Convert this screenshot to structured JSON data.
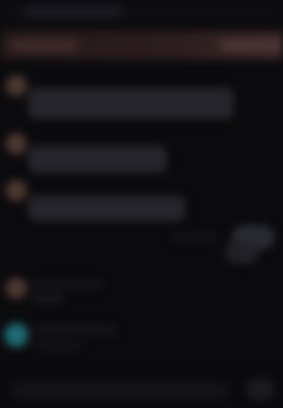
{
  "app": {
    "header_title": "",
    "background": "#0b0b0e"
  },
  "banner": {
    "text": "",
    "action": "",
    "color": "#2c1d1e"
  },
  "messages": [
    {
      "sender": "",
      "text": "",
      "avatar_color": "#4c3830"
    },
    {
      "sender": "",
      "text": "",
      "avatar_color": "#4c3830"
    },
    {
      "sender": "",
      "text": "",
      "avatar_color": "#4c3830"
    },
    {
      "sender": "",
      "text": "",
      "avatar_color": "#4c3830"
    },
    {
      "sender": "",
      "text": "",
      "avatar_color": "#1f6a72"
    }
  ],
  "outgoing": {
    "text": ""
  },
  "composer": {
    "placeholder": "",
    "send_icon": "send-icon"
  }
}
